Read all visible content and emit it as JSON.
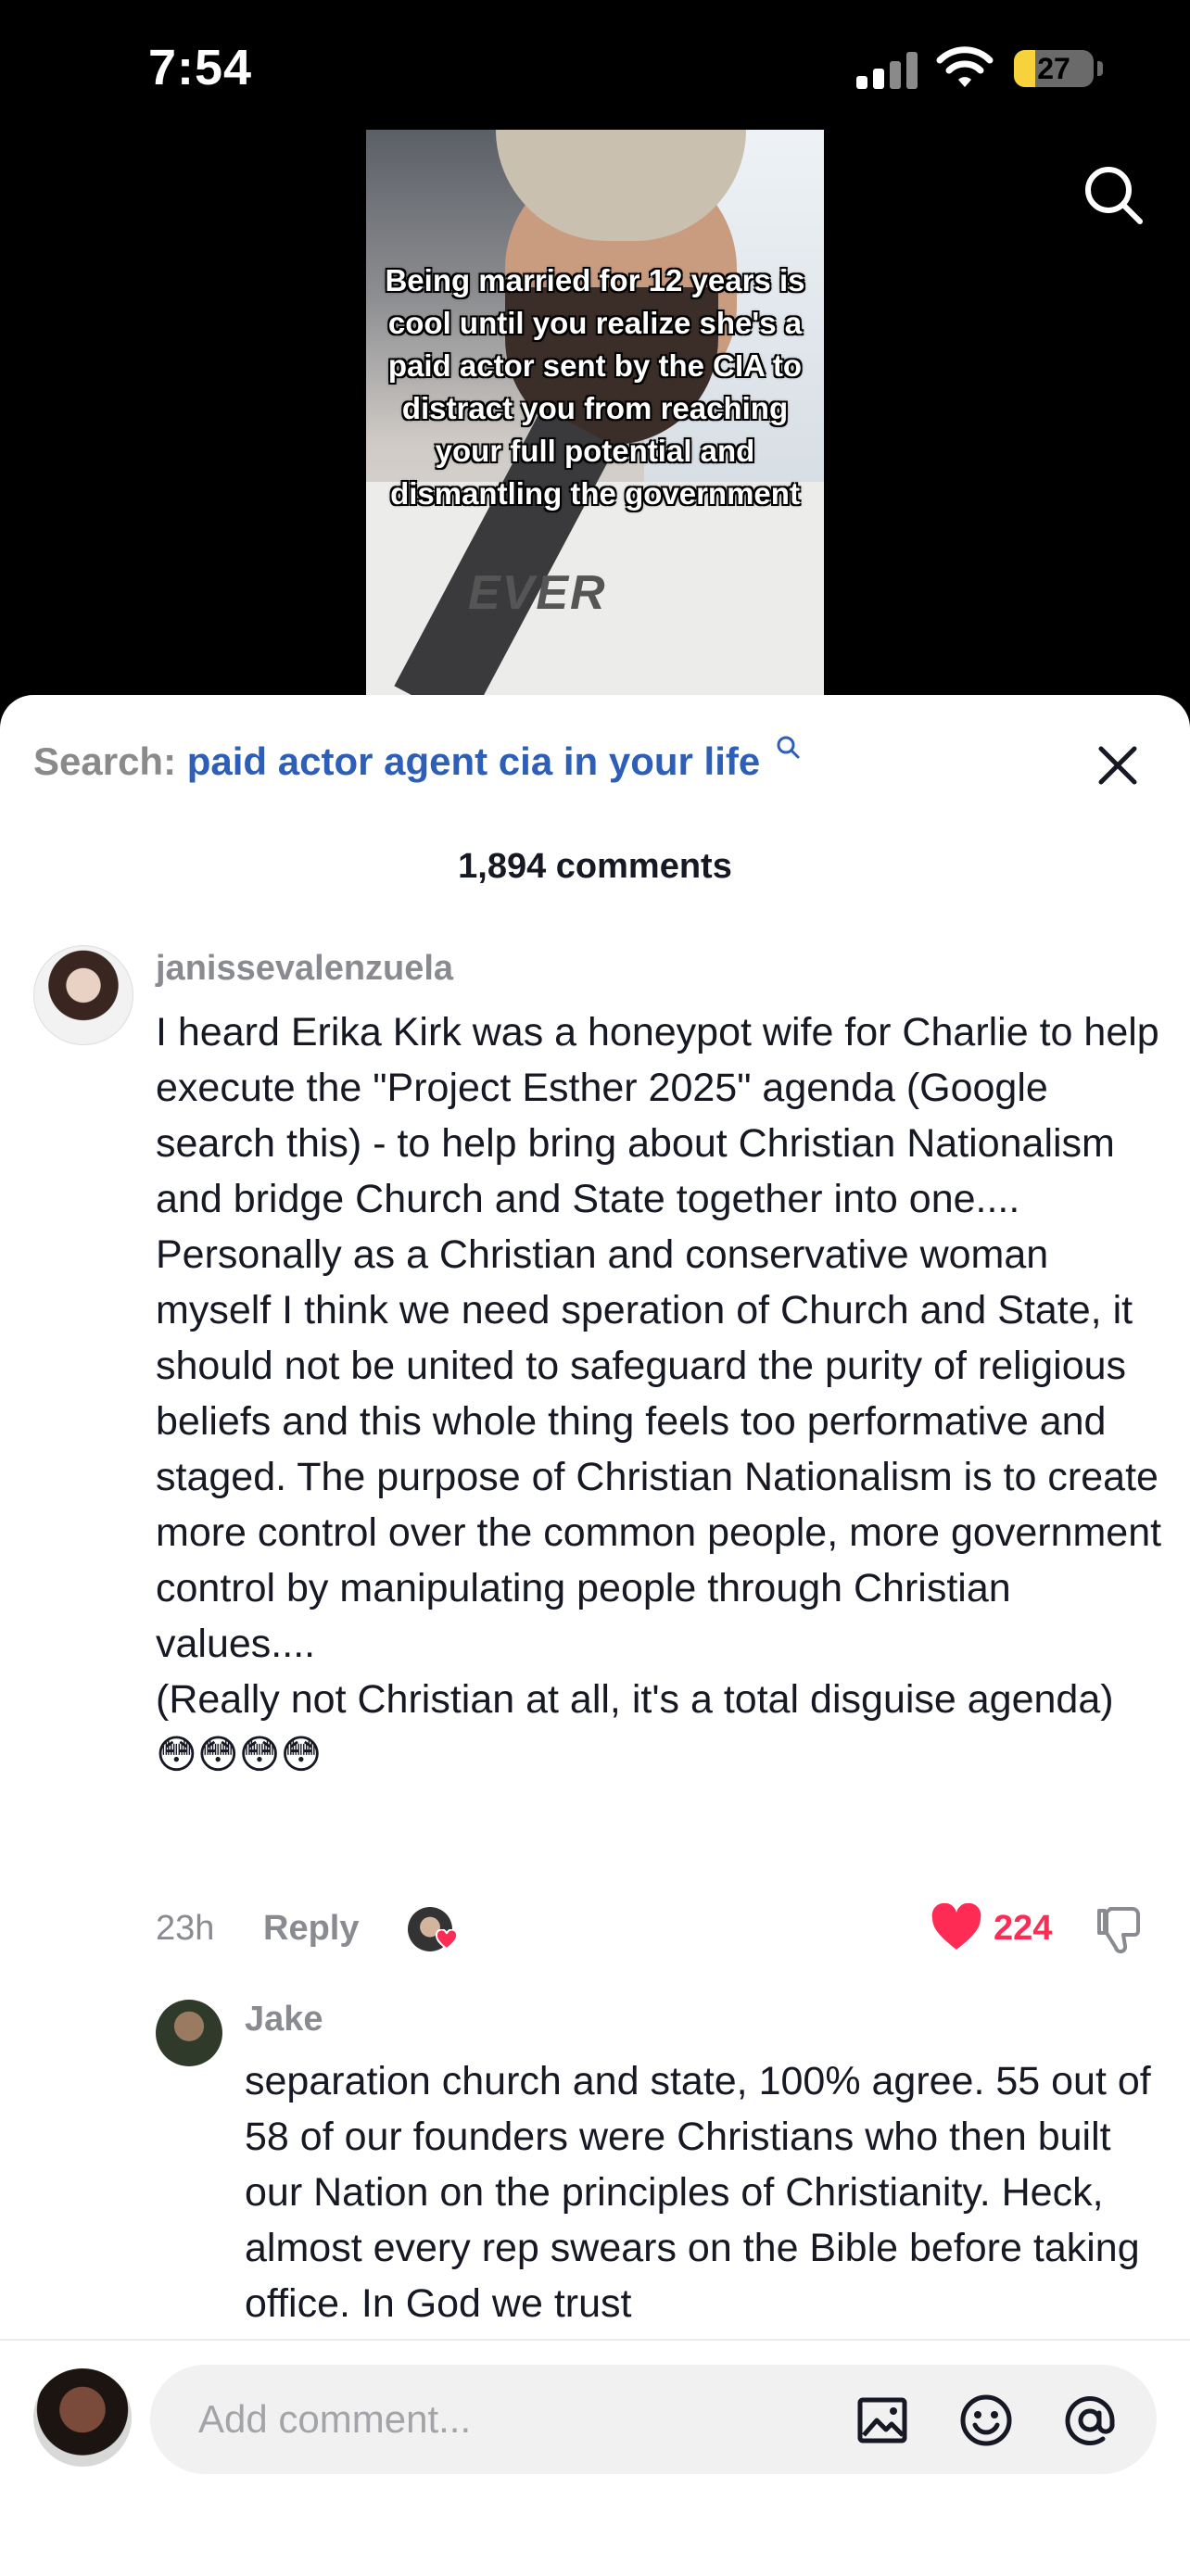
{
  "status_bar": {
    "time": "7:54",
    "battery_percent": 27,
    "battery_label": "27"
  },
  "video": {
    "caption": "Being married for 12 years is cool until you realize she's a paid actor sent by the CIA to distract you from reaching your full potential and dismantling the government",
    "shirt_text": "EVER"
  },
  "search": {
    "prefix": "Search:",
    "query": "paid actor agent cia in your life"
  },
  "comments_count": "1,894 comments",
  "comment": {
    "username": "janissevalenzuela",
    "text": "I heard Erika Kirk was a honeypot wife for Charlie to help execute the \"Project Esther 2025\" agenda (Google search this) - to help bring about Christian Nationalism and bridge Church and State together into one....\nPersonally as a Christian and conservative woman myself I think we need speration of Church and State, it should not be united to safeguard the purity of religious beliefs and this whole thing feels too performative and staged. The purpose of Christian Nationalism is to create more control over the common people, more government control by manipulating people through Christian values....\n(Really not Christian at all, it's a total disguise agenda) 😳😳😳😳",
    "time": "23h",
    "reply_label": "Reply",
    "likes": "224"
  },
  "reply": {
    "username": "Jake",
    "text": "separation church and state, 100% agree. 55 out of 58 of our founders were Christians who then built our Nation on the principles of Christianity. Heck, almost every rep swears on the Bible before taking office. In God we trust"
  },
  "input": {
    "placeholder": "Add comment..."
  },
  "colors": {
    "accent_link": "#2e5fb8",
    "like": "#fe2c55",
    "battery": "#f7d23a"
  },
  "icons": [
    "search-icon",
    "close-icon",
    "heart-icon",
    "dislike-icon",
    "image-icon",
    "emoji-icon",
    "mention-icon"
  ]
}
